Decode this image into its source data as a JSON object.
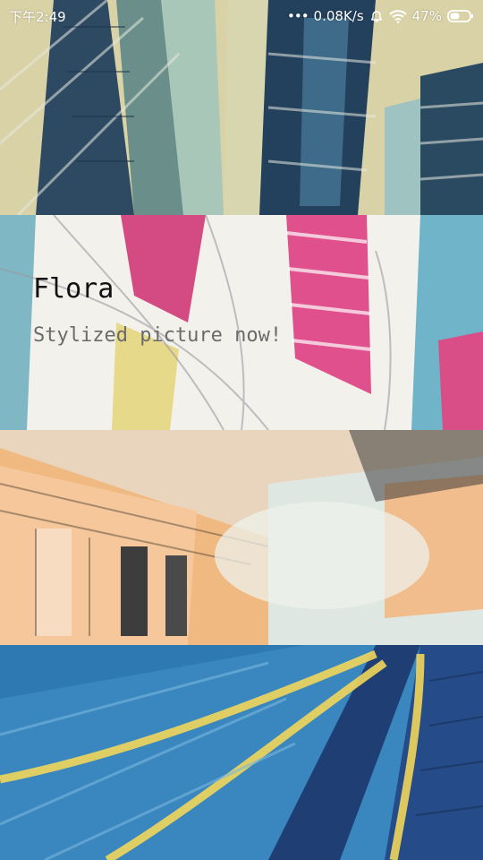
{
  "status_bar": {
    "time": "下午2:49",
    "dots": "•••",
    "network_speed": "0.08K/s",
    "battery_percent": "47%",
    "icons": [
      "alarm-icon",
      "wifi-icon",
      "battery-icon"
    ]
  },
  "hero": {
    "title": "Flora",
    "subtitle": "Stylized picture now!"
  },
  "gallery": {
    "images": [
      "stylized-city-towers",
      "stylized-pink-buildings",
      "stylized-warm-street",
      "stylized-blue-yellow-road"
    ]
  },
  "colors": {
    "title": "#111111",
    "subtitle": "#6b6b6b",
    "status_text": "#ffffff"
  }
}
